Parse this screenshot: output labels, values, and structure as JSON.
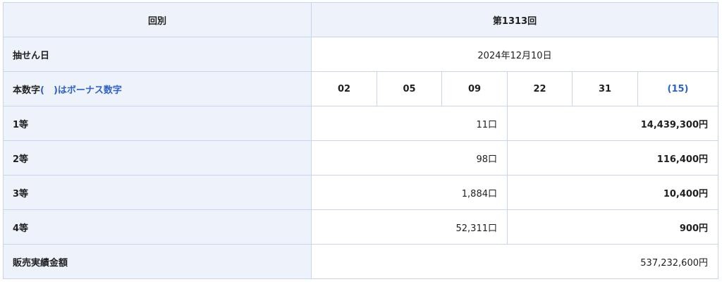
{
  "table": {
    "header": {
      "label": "回別",
      "value": "第1313回"
    },
    "draw_date": {
      "label": "抽せん日",
      "value": "2024年12月10日"
    },
    "numbers": {
      "label_main": "本数字",
      "label_bonus": "(　)はボーナス数字",
      "values": [
        "02",
        "05",
        "09",
        "22",
        "31"
      ],
      "bonus": "(15)"
    },
    "prizes": [
      {
        "label": "1等",
        "winners": "11口",
        "amount": "14,439,300円"
      },
      {
        "label": "2等",
        "winners": "98口",
        "amount": "116,400円"
      },
      {
        "label": "3等",
        "winners": "1,884口",
        "amount": "10,400円"
      },
      {
        "label": "4等",
        "winners": "52,311口",
        "amount": "900円"
      }
    ],
    "sales": {
      "label": "販売実績金額",
      "value": "537,232,600円"
    }
  },
  "colors": {
    "header_bg": "#eef2fb",
    "border": "#c9d5ee",
    "accent": "#2f62c9"
  }
}
